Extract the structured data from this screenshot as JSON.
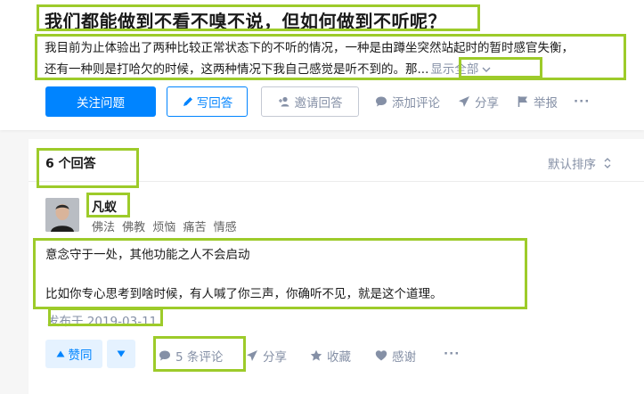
{
  "question": {
    "title": "我们都能做到不看不嗅不说，但如何做到不听呢？",
    "description_line1": "我目前为止体验出了两种比较正常状态下的不听的情况，一种是由蹲坐突然站起时的暂时感官失衡，",
    "description_line2": "还有一种则是打哈欠的时候，这两种情况下我自己感觉是听不到的。那...",
    "show_all": "显示全部",
    "actions": {
      "follow": "关注问题",
      "write_answer": "写回答",
      "invite": "邀请回答",
      "comment": "添加评论",
      "share": "分享",
      "report": "举报",
      "more": "···"
    }
  },
  "answers": {
    "count_label": "6 个回答",
    "sort_label": "默认排序"
  },
  "answer": {
    "author_name": "凡蚁",
    "author_tags": [
      "佛法",
      "佛教",
      "烦恼",
      "痛苦",
      "情感"
    ],
    "body": [
      "意念守于一处，其他功能之人不会启动",
      "比如你专心思考到啥时候，有人喊了你三声，你确听不见，就是这个道理。"
    ],
    "published": "发布于 2019-03-11",
    "actions": {
      "upvote": "赞同",
      "comments": "5 条评论",
      "share": "分享",
      "collect": "收藏",
      "thanks": "感谢",
      "more": "···"
    }
  },
  "colors": {
    "accent": "#0084ff",
    "muted": "#8590a6",
    "highlight_box": "#9dcb2a"
  }
}
